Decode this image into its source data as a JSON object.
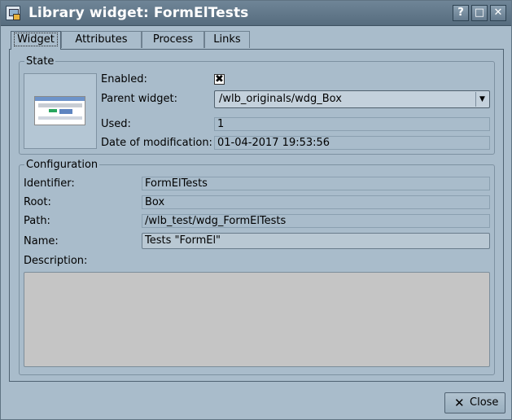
{
  "window": {
    "title": "Library widget: FormElTests",
    "buttons": [
      "?",
      "□",
      "✕"
    ]
  },
  "tabs": [
    "Widget",
    "Attributes",
    "Process",
    "Links"
  ],
  "state": {
    "legend": "State",
    "enabled_label": "Enabled:",
    "enabled_checked": true,
    "parent_label": "Parent widget:",
    "parent_value": "/wlb_originals/wdg_Box",
    "used_label": "Used:",
    "used_value": "1",
    "date_label": "Date of modification:",
    "date_value": "01-04-2017 19:53:56"
  },
  "configuration": {
    "legend": "Configuration",
    "identifier_label": "Identifier:",
    "identifier_value": "FormElTests",
    "root_label": "Root:",
    "root_value": "Box",
    "path_label": "Path:",
    "path_value": "/wlb_test/wdg_FormElTests",
    "name_label": "Name:",
    "name_value": "Tests \"FormEl\"",
    "description_label": "Description:",
    "description_value": ""
  },
  "footer": {
    "close_label": "Close"
  },
  "colors": {
    "window_bg": "#a9bccb",
    "titlebar": "#566c7e",
    "description_bg": "#c5c5c5"
  }
}
